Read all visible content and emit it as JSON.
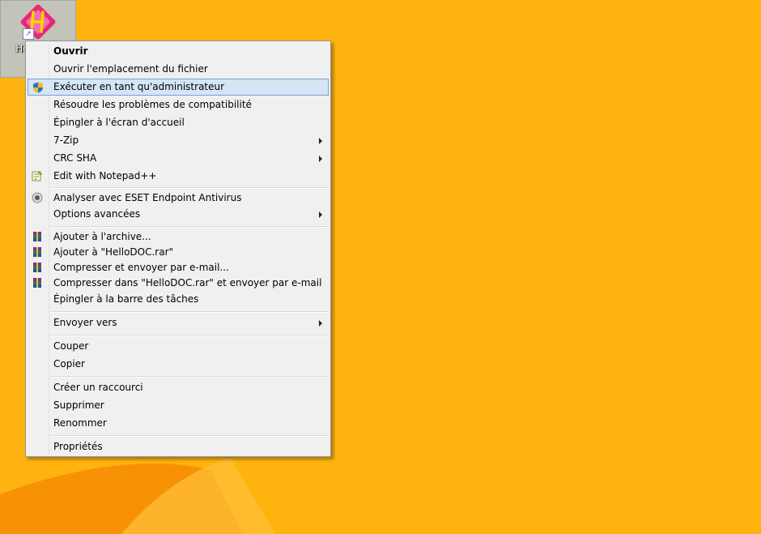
{
  "colors": {
    "wallpaper": "#FFB30E",
    "menu_background": "#F0F0F0",
    "menu_highlight": "#D5E5F6",
    "menu_highlight_border": "#7DA2CE"
  },
  "desktop": {
    "icon": {
      "label": "HelloDOC",
      "icon_name": "hellodoc-app-icon",
      "shortcut_icon": "shortcut-arrow-icon"
    }
  },
  "menu": {
    "items": [
      {
        "label": "Ouvrir",
        "bold": true
      },
      {
        "label": "Ouvrir l'emplacement du fichier"
      },
      {
        "label": "Exécuter en tant qu'administrateur",
        "icon": "uac-shield-icon",
        "highlighted": true
      },
      {
        "label": "Résoudre les problèmes de compatibilité"
      },
      {
        "label": "Épingler à l'écran d'accueil"
      },
      {
        "label": "7-Zip",
        "submenu": true
      },
      {
        "label": "CRC SHA",
        "submenu": true
      },
      {
        "label": "Edit with Notepad++",
        "icon": "notepadpp-icon"
      },
      {
        "label": "Analyser avec ESET Endpoint Antivirus",
        "icon": "eset-icon"
      },
      {
        "label": "Options avancées",
        "submenu": true
      },
      {
        "label": "Ajouter à l'archive...",
        "icon": "winrar-icon"
      },
      {
        "label": "Ajouter à \"HelloDOC.rar\"",
        "icon": "winrar-icon"
      },
      {
        "label": "Compresser et envoyer par e-mail...",
        "icon": "winrar-icon"
      },
      {
        "label": "Compresser dans \"HelloDOC.rar\" et envoyer par e-mail",
        "icon": "winrar-icon"
      },
      {
        "label": "Épingler à la barre des tâches"
      },
      {
        "label": "Envoyer vers",
        "submenu": true
      },
      {
        "label": "Couper"
      },
      {
        "label": "Copier"
      },
      {
        "label": "Créer un raccourci"
      },
      {
        "label": "Supprimer"
      },
      {
        "label": "Renommer"
      },
      {
        "label": "Propriétés"
      }
    ]
  }
}
